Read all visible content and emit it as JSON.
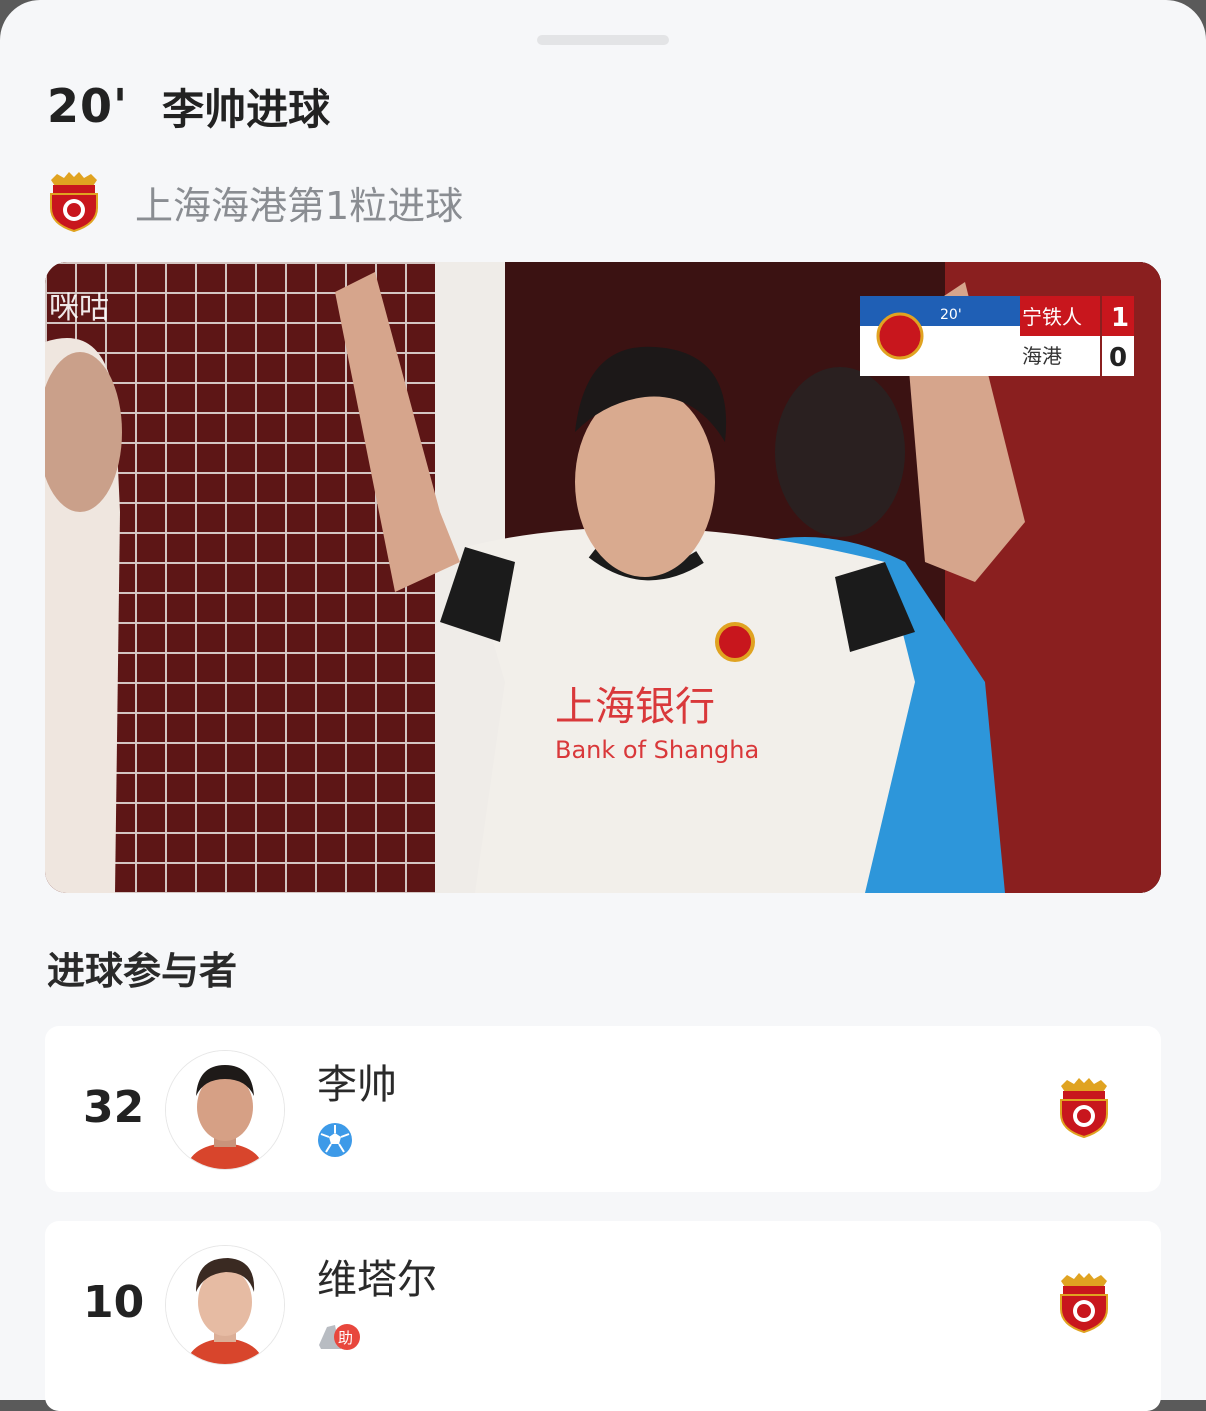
{
  "header": {
    "minute": "20'",
    "title": "李帅进球"
  },
  "team_line": {
    "text": "上海海港第1粒进球",
    "crest_icon": "shanghai-port-crest"
  },
  "video": {
    "watermark": "咪咕",
    "scoreboard": {
      "time": "20'",
      "home_team": "宁铁人",
      "home_score": "1",
      "away_team": "海港",
      "away_score": "0"
    },
    "sponsor_cn": "上海银行",
    "sponsor_en": "Bank of Shangha"
  },
  "section_title": "进球参与者",
  "participants": [
    {
      "number": "32",
      "name": "李帅",
      "action_icon": "football-icon"
    },
    {
      "number": "10",
      "name": "维塔尔",
      "action_icon": "assist-boot-icon",
      "assist_badge": "助"
    }
  ],
  "colors": {
    "brand_red": "#c8161d",
    "crest_gold": "#e0a321",
    "ball_blue": "#3d9ae8",
    "assist_red": "#e8473d"
  }
}
